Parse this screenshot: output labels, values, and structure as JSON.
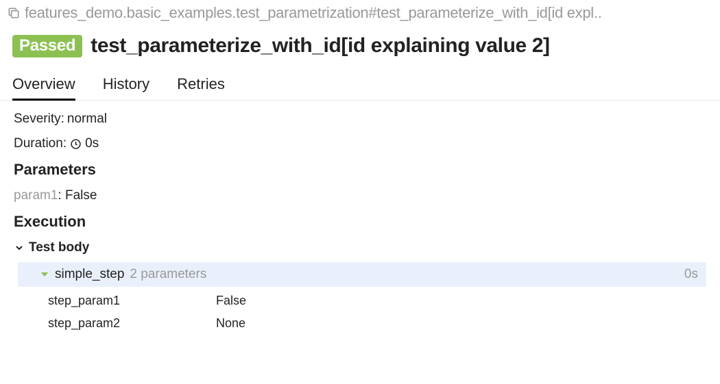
{
  "breadcrumb": "features_demo.basic_examples.test_parametrization#test_parameterize_with_id[id expl..",
  "status": "Passed",
  "title": "test_parameterize_with_id[id explaining value 2]",
  "tabs": [
    "Overview",
    "History",
    "Retries"
  ],
  "active_tab": "Overview",
  "severity": {
    "label": "Severity:",
    "value": "normal"
  },
  "duration": {
    "label": "Duration:",
    "value": "0s"
  },
  "sections": {
    "parameters_heading": "Parameters",
    "execution_heading": "Execution",
    "test_body_heading": "Test body"
  },
  "parameters": [
    {
      "name": "param1",
      "value": "False"
    }
  ],
  "step": {
    "name": "simple_step",
    "meta": "2 parameters",
    "duration": "0s",
    "params": [
      {
        "name": "step_param1",
        "value": "False"
      },
      {
        "name": "step_param2",
        "value": "None"
      }
    ]
  }
}
